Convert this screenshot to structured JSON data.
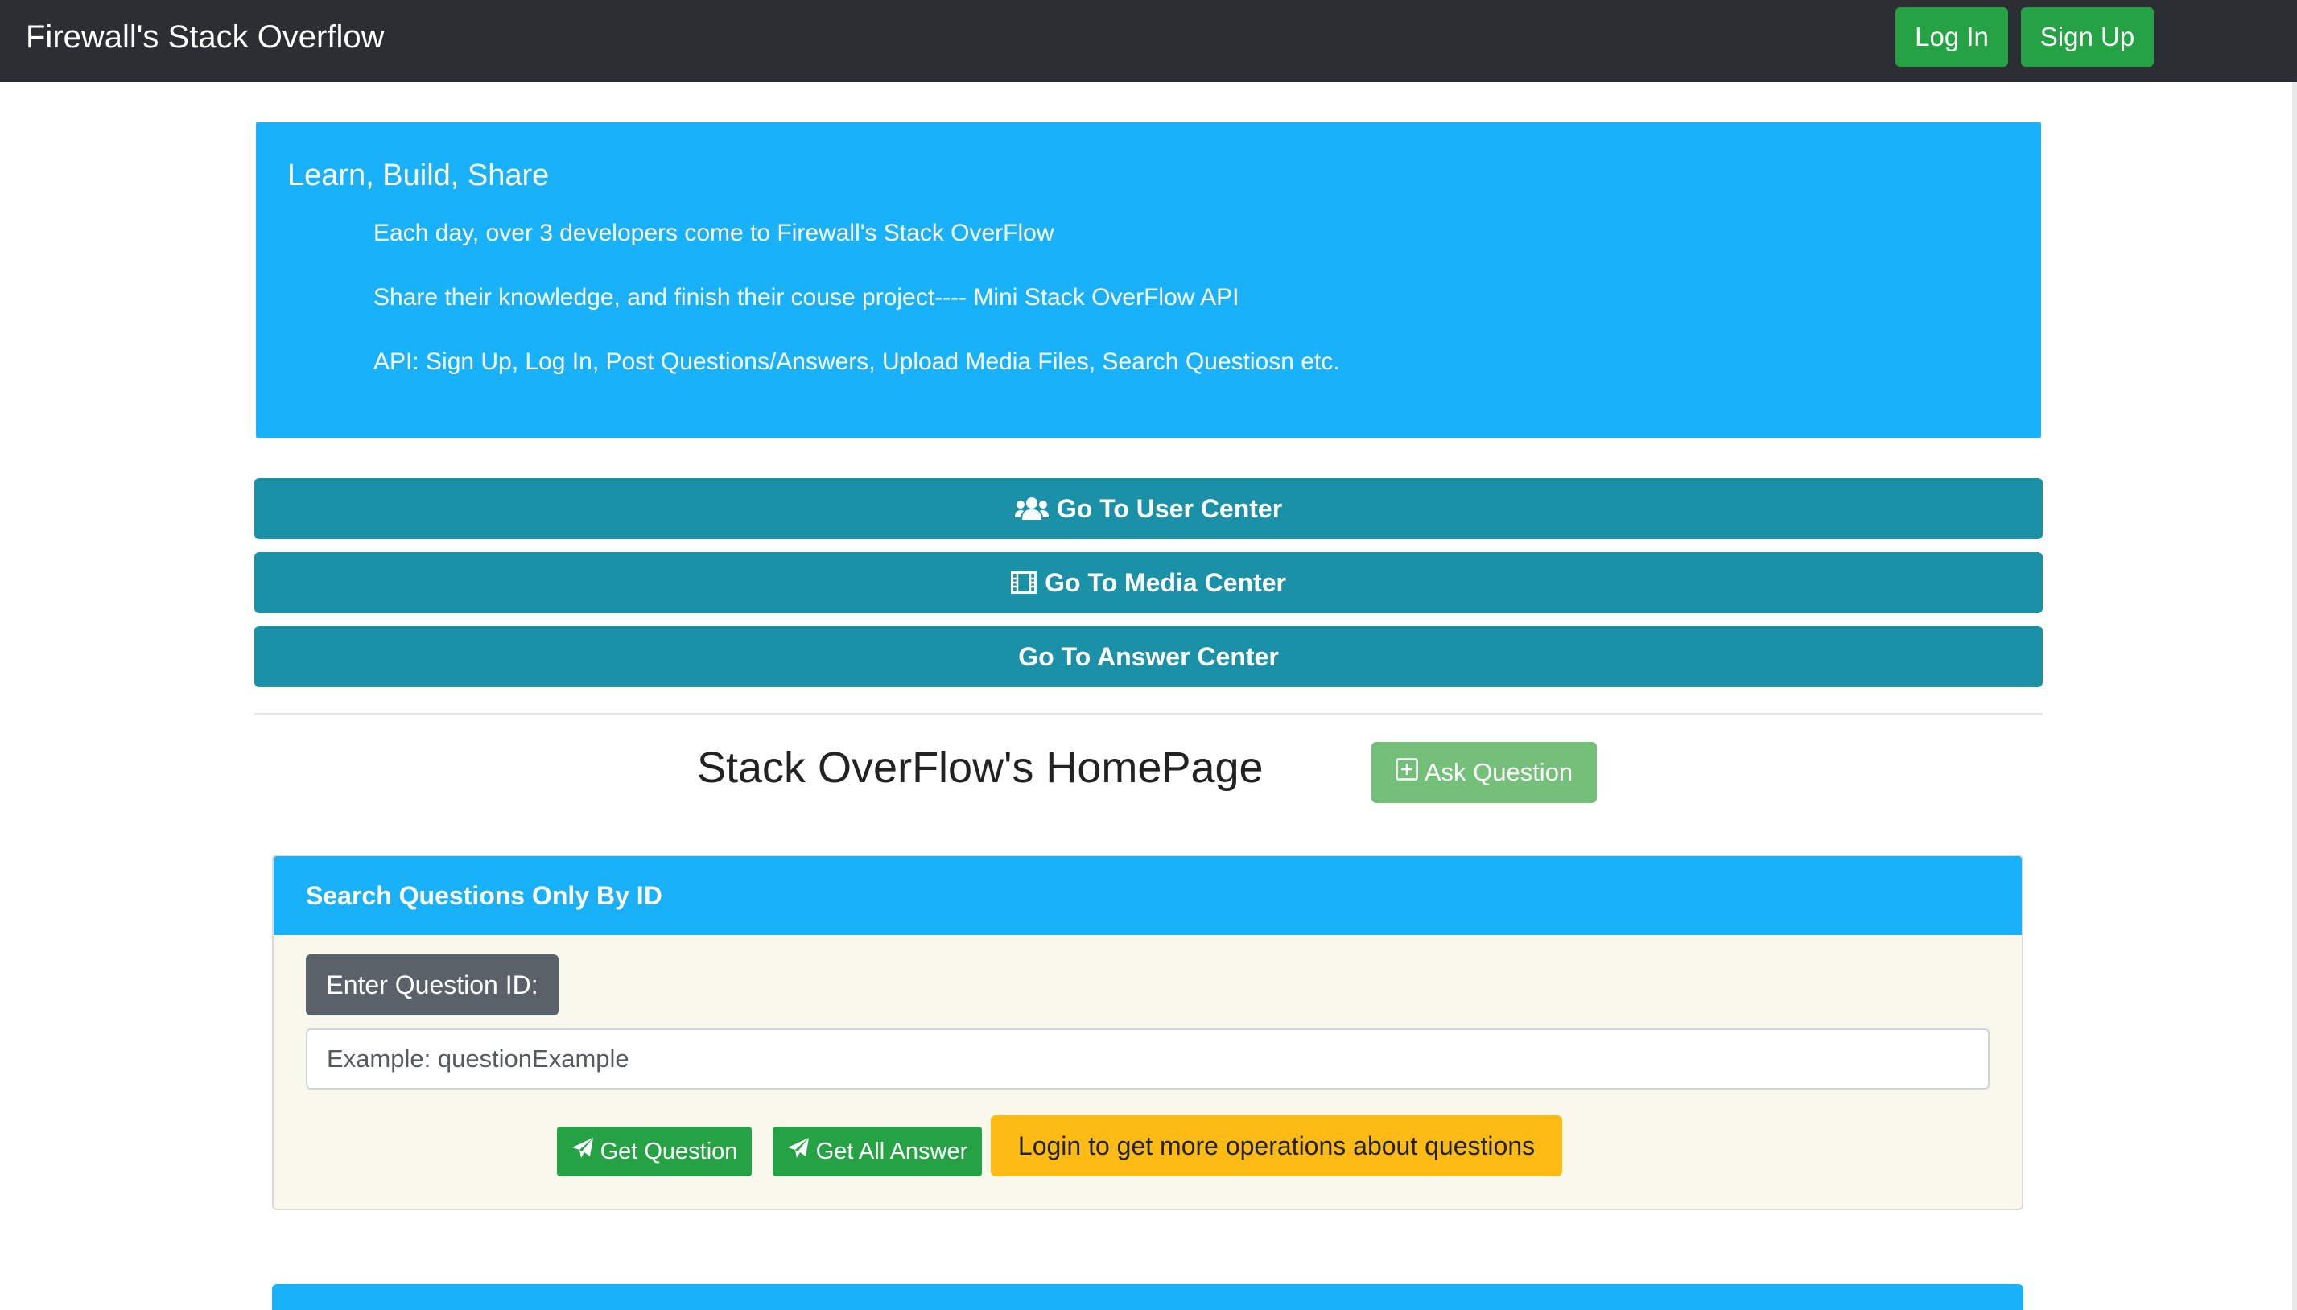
{
  "navbar": {
    "brand": "Firewall's Stack Overflow",
    "login_label": "Log In",
    "signup_label": "Sign Up"
  },
  "jumbotron": {
    "heading": "Learn, Build, Share",
    "line1": "Each day, over 3 developers come to Firewall's Stack OverFlow",
    "line2": "Share their knowledge, and finish their couse project---- Mini Stack OverFlow API",
    "line3": "API: Sign Up, Log In, Post Questions/Answers, Upload Media Files, Search Questiosn etc."
  },
  "centers": {
    "user_label": "Go To User Center",
    "user_icon": "users-icon",
    "media_label": "Go To Media Center",
    "media_icon": "film-icon",
    "answer_label": "Go To Answer Center"
  },
  "homepage": {
    "title": "Stack OverFlow's HomePage",
    "ask_label": "Ask Question",
    "ask_icon": "plus-square-icon"
  },
  "search_card": {
    "header": "Search Questions Only By ID",
    "id_label": "Enter Question ID:",
    "input_value": "",
    "input_placeholder": "Example: questionExample",
    "get_question_label": "Get Question",
    "get_all_answer_label": "Get All Answer",
    "send_icon": "paper-plane-icon",
    "login_more_label": "Login to get more operations about questions"
  },
  "colors": {
    "navbar": "#2b2f33",
    "primary_blue": "#1ab1fb",
    "info_teal": "#1a91a7",
    "success_green": "#25a244",
    "ask_green": "#74c07a",
    "warning_yellow": "#fdbb13",
    "secondary_gray": "#5a6168",
    "card_bg": "#f8f8ec"
  }
}
